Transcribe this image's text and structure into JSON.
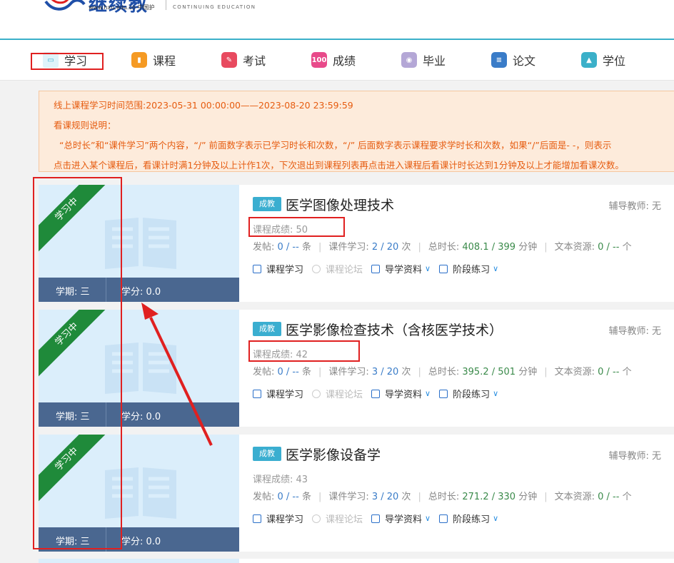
{
  "header": {
    "logo_cn": "继续教",
    "logo_url": "www.hxu.edu.cn 中国护",
    "logo_en": "CONTINUING EDUCATION"
  },
  "nav": {
    "items": [
      {
        "label": "学习",
        "icon": "book-icon",
        "color": "#3aaed0"
      },
      {
        "label": "课程",
        "icon": "bookmark-icon",
        "color": "#f59a23"
      },
      {
        "label": "考试",
        "icon": "pencil-icon",
        "color": "#e84a5f"
      },
      {
        "label": "成绩",
        "icon": "score-icon",
        "color": "#e84a8a"
      },
      {
        "label": "毕业",
        "icon": "graduation-icon",
        "color": "#8e7cc3"
      },
      {
        "label": "论文",
        "icon": "document-icon",
        "color": "#3a7cc8"
      },
      {
        "label": "学位",
        "icon": "mortarboard-icon",
        "color": "#3bb0c9"
      }
    ]
  },
  "notice": {
    "line1": "线上课程学习时间范围:2023-05-31 00:00:00——2023-08-20 23:59:59",
    "line2": "看课规则说明：",
    "line3": "“总时长”和“课件学习”两个内容，“/” 前面数字表示已学习时长和次数，“/” 后面数字表示课程要求学时长和次数，如果“/”后面是- -，则表示",
    "line4": "点击进入某个课程后，看课计时满1分钟及以上计作1次，下次退出到课程列表再点击进入课程后看课计时长达到1分钟及以上才能增加看课次数。"
  },
  "labels": {
    "ribbon": "学习中",
    "term_label": "学期: 三",
    "credit_label": "学分: 0.0",
    "badge": "成教",
    "tutor": "辅导教师: 无",
    "posts_label": "发帖: ",
    "courseware_label": "课件学习: ",
    "total_label": "总时长: ",
    "text_label": "文本资源: ",
    "unit_tiao": " 条",
    "unit_ci": " 次",
    "unit_min": " 分钟",
    "unit_ge": " 个",
    "action_study": "课程学习",
    "action_forum": "课程论坛",
    "action_guide": "导学资料",
    "action_practice": "阶段练习"
  },
  "courses": [
    {
      "title": "医学图像处理技术",
      "score": "课程成绩: 50",
      "posts": "0 / --",
      "courseware": "2 / 20",
      "total": "408.1 / 399",
      "text": "0 / --"
    },
    {
      "title": "医学影像检查技术（含核医学技术）",
      "score": "课程成绩: 42",
      "posts": "0 / --",
      "courseware": "3 / 20",
      "total": "395.2 / 501",
      "text": "0 / --"
    },
    {
      "title": "医学影像设备学",
      "score": "课程成绩: 43",
      "posts": "0 / --",
      "courseware": "3 / 20",
      "total": "271.2 / 330",
      "text": "0 / --"
    }
  ],
  "colors": {
    "accent": "#3aaed0",
    "ribbon": "#1f8a3a",
    "bar": "#4a6790",
    "highlight": "#e02020"
  }
}
